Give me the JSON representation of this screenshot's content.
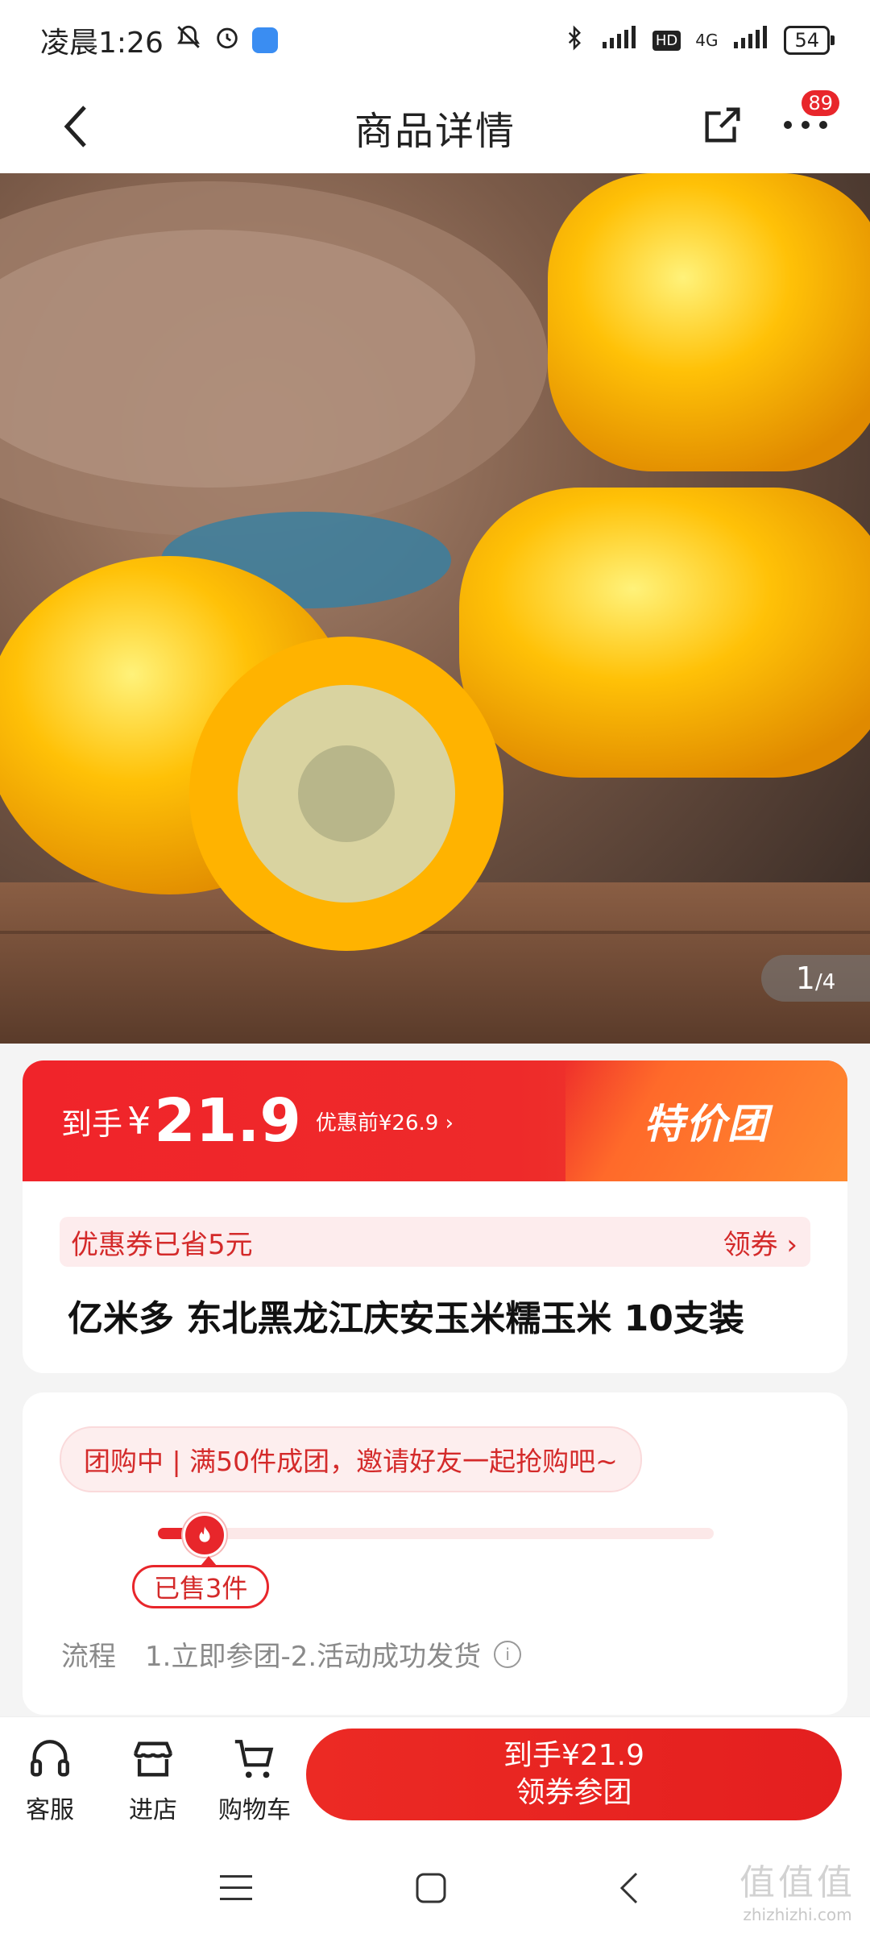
{
  "status_bar": {
    "time": "凌晨1:26",
    "network": "4G",
    "battery": "54"
  },
  "header": {
    "title": "商品详情",
    "more_badge": "89"
  },
  "gallery": {
    "current": "1",
    "total": "/4"
  },
  "price": {
    "label": "到手",
    "currency": "¥",
    "value": "21.9",
    "original": "优惠前¥26.9 ›",
    "campaign": "特价团"
  },
  "coupon": {
    "text": "优惠券已省5元",
    "action": "领券 ›"
  },
  "product": {
    "title": "亿米多 东北黑龙江庆安玉米糯玉米 10支装"
  },
  "group_buy": {
    "status": "团购中 | 满50件成团，邀请好友一起抢购吧~",
    "sold": "已售3件",
    "progress": 0.06,
    "flow_label": "流程",
    "flow_steps": "1.立即参团-2.活动成功发货",
    "info_icon": "i"
  },
  "bottom_bar": {
    "service": "客服",
    "store": "进店",
    "cart": "购物车",
    "buy_line1": "到手¥21.9",
    "buy_line2": "领券参团"
  },
  "watermark": {
    "main": "值值值",
    "sub": "zhizhizhi.com"
  },
  "colors": {
    "accent": "#e8262b",
    "coupon_bg": "#fdeced",
    "page_bg": "#f4f4f4"
  }
}
